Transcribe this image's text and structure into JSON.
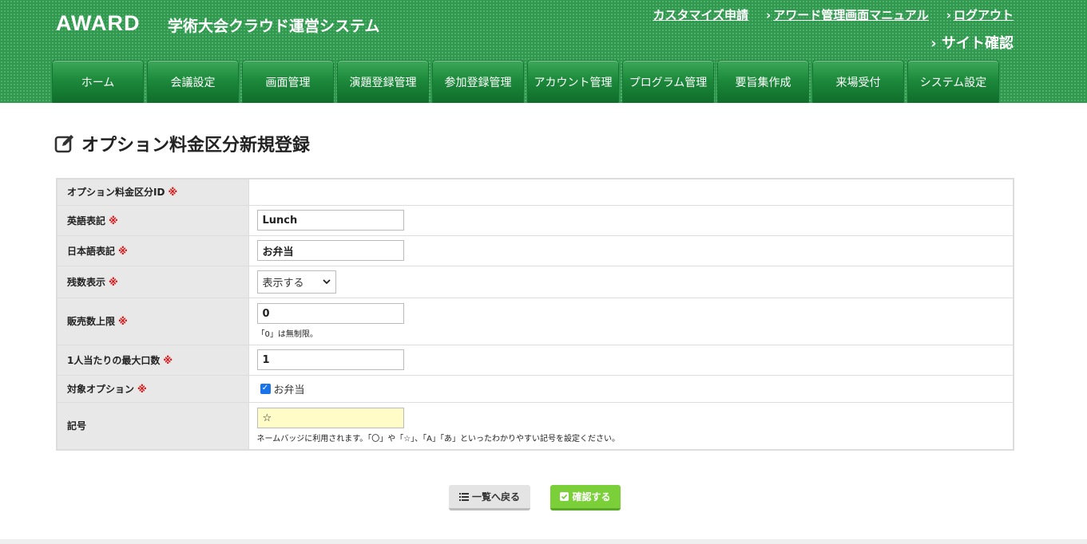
{
  "header": {
    "logo": "AWARD",
    "system_name": "学術大会クラウド運営システム",
    "links": [
      {
        "label": "カスタマイズ申請",
        "chevron": false
      },
      {
        "label": "アワード管理画面マニュアル",
        "chevron": true
      },
      {
        "label": "ログアウト",
        "chevron": true
      }
    ],
    "site_check": "サイト確認",
    "chevron": "›"
  },
  "nav": {
    "tabs": [
      {
        "label": "ホーム"
      },
      {
        "label": "会議設定"
      },
      {
        "label": "画面管理"
      },
      {
        "label": "演題登録管理"
      },
      {
        "label": "参加登録管理"
      },
      {
        "label": "アカウント管理"
      },
      {
        "label": "プログラム管理"
      },
      {
        "label": "要旨集作成"
      },
      {
        "label": "来場受付"
      },
      {
        "label": "システム設定"
      }
    ]
  },
  "page": {
    "title": "オプション料金区分新規登録",
    "title_icon": "edit-icon"
  },
  "form": {
    "required_mark": "※",
    "fields": {
      "option_id": {
        "label": "オプション料金区分ID",
        "value": ""
      },
      "english": {
        "label": "英語表記",
        "value": "Lunch"
      },
      "japanese": {
        "label": "日本語表記",
        "value": "お弁当"
      },
      "remaining": {
        "label": "残数表示",
        "selected": "表示する"
      },
      "sales_limit": {
        "label": "販売数上限",
        "value": "0",
        "hint": "「0」は無制限。"
      },
      "max_per_person": {
        "label": "1人当たりの最大口数",
        "value": "1"
      },
      "target_option": {
        "label": "対象オプション",
        "checkbox_label": "お弁当",
        "checked": true
      },
      "symbol": {
        "label": "記号",
        "value": "☆",
        "hint": "ネームバッジに利用されます。「〇」や「☆」、「A」「あ」といったわかりやすい記号を設定ください。"
      }
    }
  },
  "buttons": {
    "back": "一覧へ戻る",
    "confirm": "確認する"
  },
  "colors": {
    "header_green": "#2f9a4e",
    "tab_green": "#1d8a3c",
    "confirm_green": "#7bd03a",
    "required_red": "#dd1111",
    "symbol_field_bg": "#fffcc8"
  }
}
